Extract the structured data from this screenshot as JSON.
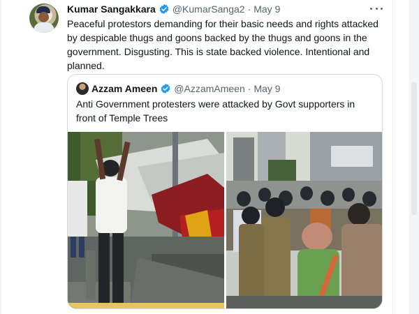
{
  "tweet": {
    "author_name": "Kumar Sangakkara",
    "author_handle": "@KumarSanga2",
    "separator": "·",
    "date": "May 9",
    "text": "Peaceful protestors demanding for their basic needs and rights attacked by despicable thugs and goons backed by the thugs and goons in the government. Disgusting. This is state  backed violence. Intentional and planned.",
    "verified": true
  },
  "quoted_tweet": {
    "author_name": "Azzam Ameen",
    "author_handle": "@AzzamAmeen",
    "separator": "·",
    "date": "May 9",
    "text": "Anti Government protesters were attacked by Govt supporters in front of Temple Trees",
    "verified": true,
    "media_items": [
      "photo",
      "photo"
    ]
  },
  "icons": {
    "more": "more-horizontal-icon",
    "verified": "verified-badge-icon"
  },
  "colors": {
    "text_primary": "#0f1419",
    "text_secondary": "#536471",
    "verified_blue": "#1d9bf0",
    "border": "#cfd9de"
  }
}
